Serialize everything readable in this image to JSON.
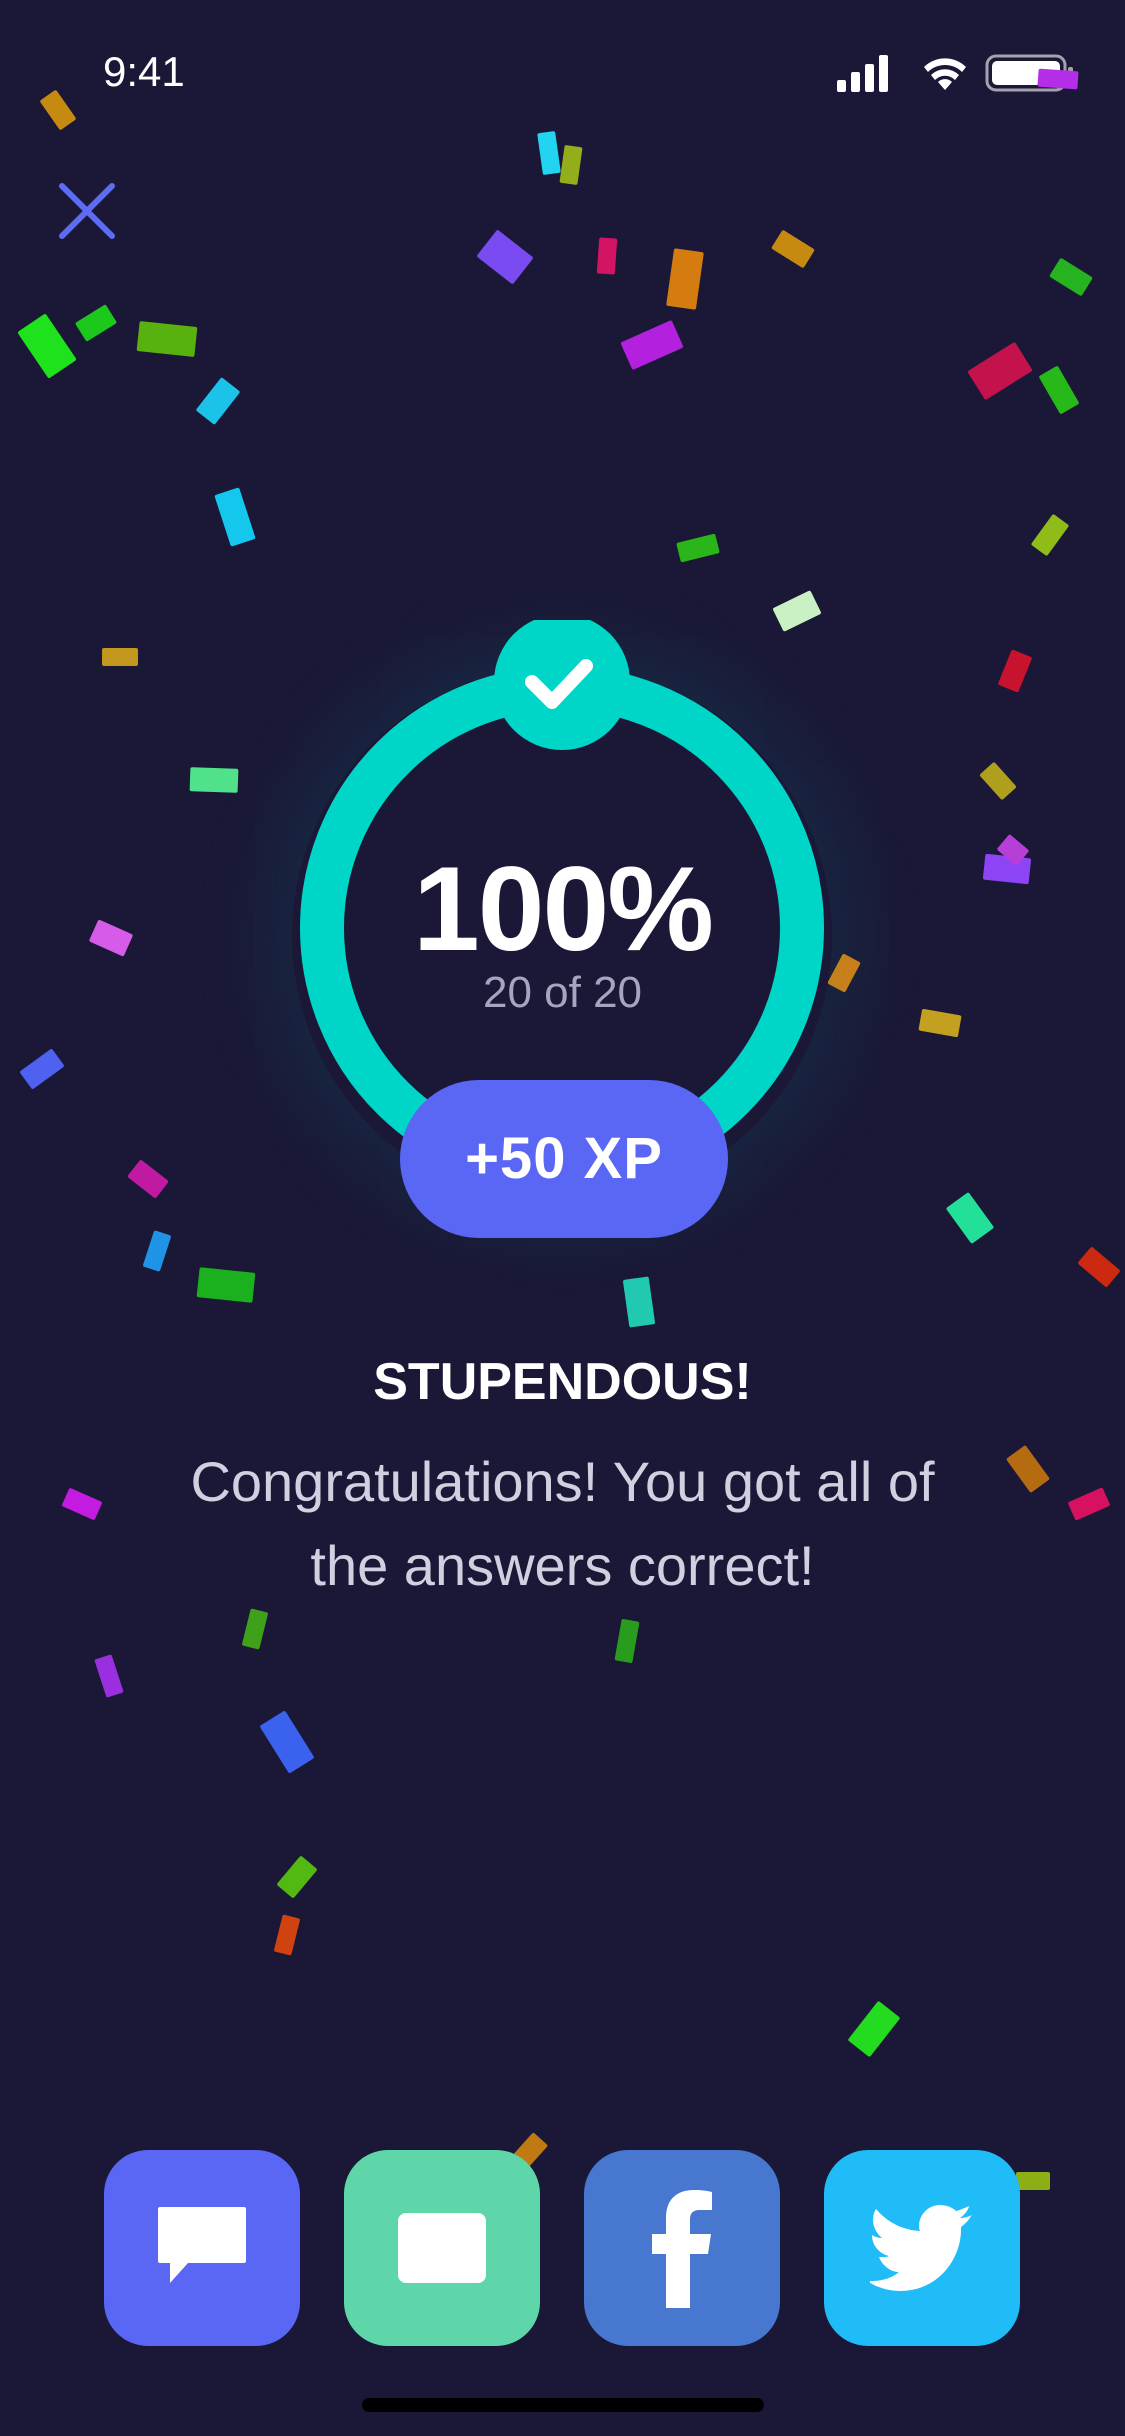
{
  "status_bar": {
    "time": "9:41"
  },
  "result": {
    "percent": "100%",
    "count": "20 of 20",
    "xp": "+50 XP"
  },
  "message": {
    "headline": "STUPENDOUS!",
    "body": "Congratulations! You got all of the answers correct!"
  },
  "share": [
    {
      "name": "message",
      "icon": "chat-bubble-icon",
      "color": "#5a67f5"
    },
    {
      "name": "email",
      "icon": "mail-icon",
      "color": "#5ed6a9"
    },
    {
      "name": "facebook",
      "icon": "facebook-icon",
      "color": "#4877cf"
    },
    {
      "name": "twitter",
      "icon": "twitter-bird-icon",
      "color": "#1fbcf7"
    }
  ],
  "colors": {
    "background": "#1a1836",
    "ring": "#00d6c8",
    "xp_pill": "#5a67f5"
  }
}
